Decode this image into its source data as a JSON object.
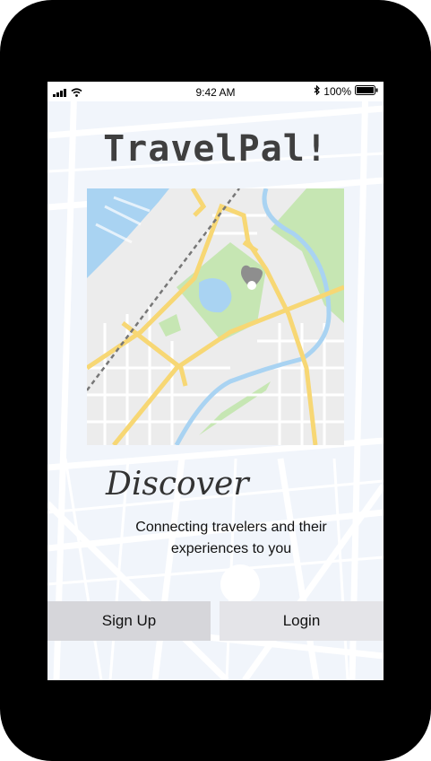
{
  "status_bar": {
    "time": "9:42 AM",
    "battery_percent": "100%",
    "signal_icon": "cellular-signal-icon",
    "wifi_icon": "wifi-icon",
    "bluetooth_icon": "bluetooth-icon",
    "battery_icon": "battery-icon"
  },
  "app": {
    "title": "TravelPal!"
  },
  "hero": {
    "heading": "Discover",
    "tagline": "Connecting travelers and their experiences to you"
  },
  "actions": {
    "signup_label": "Sign Up",
    "login_label": "Login"
  },
  "colors": {
    "title": "#3f3f3f",
    "signup_bg": "#d6d6da",
    "login_bg": "#e4e4e8",
    "map_road": "#f7d774",
    "map_park": "#c6e6b3",
    "map_water": "#a9d3f2",
    "pin": "#8e8e8e"
  }
}
